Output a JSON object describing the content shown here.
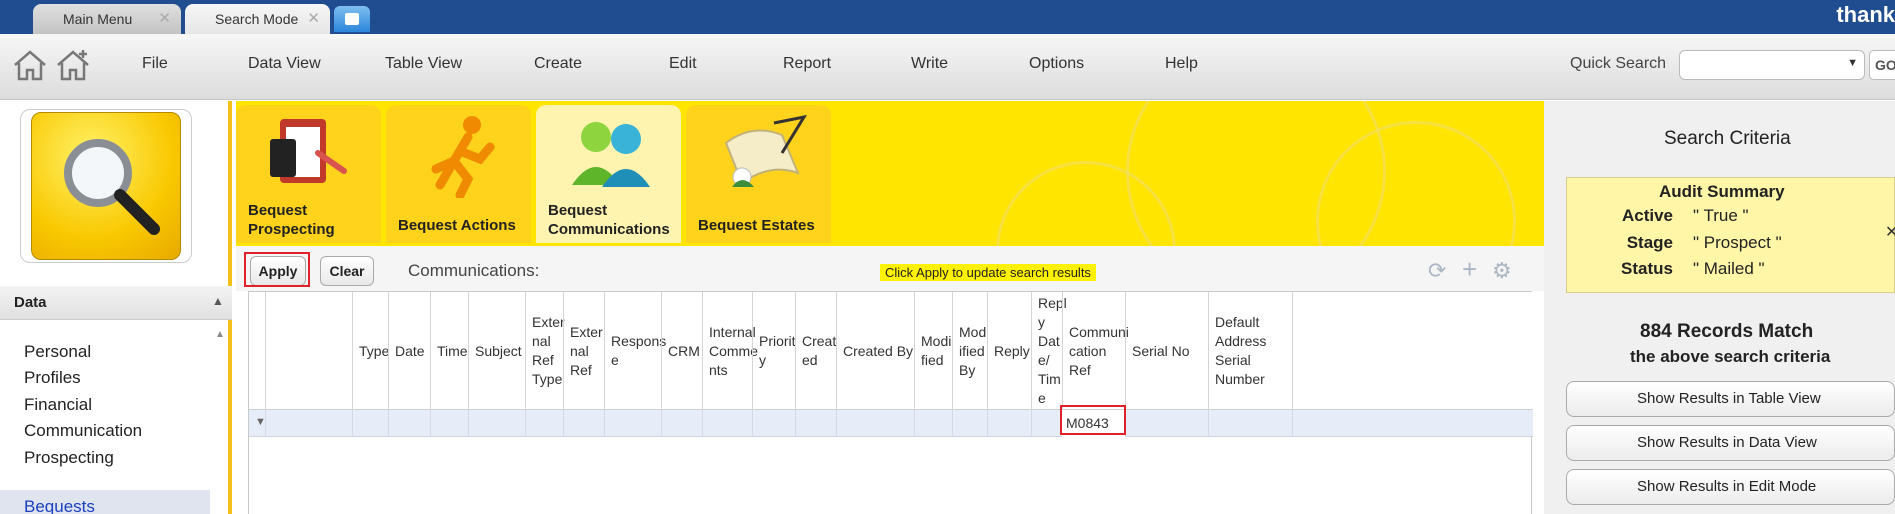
{
  "tabs": [
    {
      "label": "Main Menu"
    },
    {
      "label": "Search Mode"
    }
  ],
  "brand": "thank",
  "menu": [
    "File",
    "Data View",
    "Table View",
    "Create",
    "Edit",
    "Report",
    "Write",
    "Options",
    "Help"
  ],
  "quick_search": {
    "label": "Quick Search",
    "value": "",
    "go_label": "GO"
  },
  "sidebar": {
    "section": "Data",
    "items": [
      {
        "label": "Personal"
      },
      {
        "label": "Profiles"
      },
      {
        "label": "Financial"
      },
      {
        "label": "Communication"
      },
      {
        "label": "Prospecting"
      },
      {
        "label": "Bequests"
      }
    ]
  },
  "categories": [
    {
      "label": "Bequest Prospecting"
    },
    {
      "label": "Bequest Actions"
    },
    {
      "label": "Bequest Communications"
    },
    {
      "label": "Bequest Estates"
    }
  ],
  "toolbar": {
    "apply_label": "Apply",
    "clear_label": "Clear",
    "title": "Communications:",
    "hint": "Click Apply to update search results"
  },
  "grid": {
    "columns": [
      {
        "label": "Type"
      },
      {
        "label": "Date"
      },
      {
        "label": "Time"
      },
      {
        "label": "Subject"
      },
      {
        "label": "External Ref Type"
      },
      {
        "label": "External Ref"
      },
      {
        "label": "Response"
      },
      {
        "label": "CRM"
      },
      {
        "label": "Internal Comments"
      },
      {
        "label": "Priority"
      },
      {
        "label": "Created"
      },
      {
        "label": "Created By"
      },
      {
        "label": "Modified"
      },
      {
        "label": "Modified By"
      },
      {
        "label": "Reply"
      },
      {
        "label": "Reply Date/Time"
      },
      {
        "label": "Communication Ref"
      },
      {
        "label": "Serial No"
      },
      {
        "label": "Default Address Serial Number"
      }
    ],
    "filter_value": "M0843"
  },
  "right": {
    "title": "Search Criteria",
    "audit": {
      "title": "Audit Summary",
      "rows": [
        {
          "key": "Active",
          "value": "\" True \""
        },
        {
          "key": "Stage",
          "value": "\" Prospect \""
        },
        {
          "key": "Status",
          "value": "\" Mailed \""
        }
      ]
    },
    "records": "884 Records Match",
    "records_sub": "the above search criteria",
    "buttons": [
      {
        "label": "Show Results in Table View"
      },
      {
        "label": "Show Results in Data View"
      },
      {
        "label": "Show Results in Edit Mode"
      }
    ]
  },
  "colors": {
    "accent_blue": "#1f4d8f",
    "brand_yellow": "#ffe500",
    "highlight_red": "#e0202a"
  }
}
